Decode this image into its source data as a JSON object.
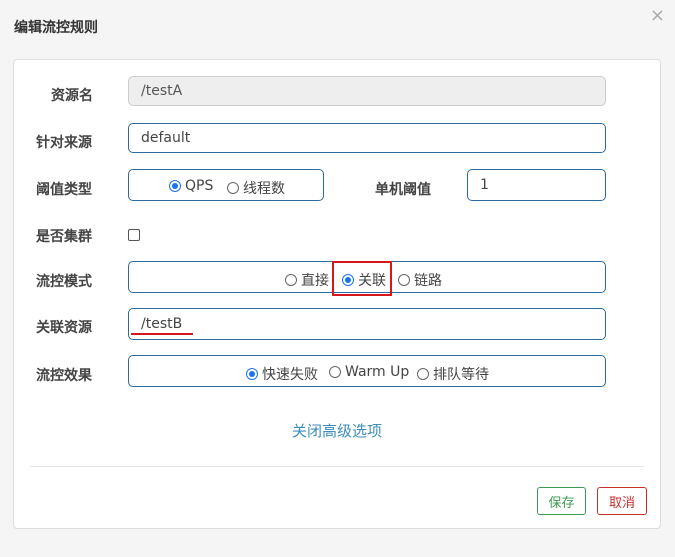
{
  "dialog": {
    "title": "编辑流控规则",
    "close_glyph": "×"
  },
  "form": {
    "resource_name": {
      "label": "资源名",
      "value": "/testA"
    },
    "limit_app": {
      "label": "针对来源",
      "value": "default"
    },
    "threshold_type": {
      "label": "阈值类型",
      "options": [
        "QPS",
        "线程数"
      ],
      "selected": "QPS"
    },
    "single_threshold": {
      "label": "单机阈值",
      "value": "1"
    },
    "cluster_mode": {
      "label": "是否集群",
      "checked": false
    },
    "control_mode": {
      "label": "流控模式",
      "options": [
        "直接",
        "关联",
        "链路"
      ],
      "selected": "关联"
    },
    "ref_resource": {
      "label": "关联资源",
      "value": "/testB"
    },
    "control_effect": {
      "label": "流控效果",
      "options": [
        "快速失败",
        "Warm Up",
        "排队等待"
      ],
      "selected": "快速失败"
    },
    "advanced_toggle": "关闭高级选项"
  },
  "footer": {
    "save_label": "保存",
    "cancel_label": "取消"
  },
  "colors": {
    "accent": "#1a73e8",
    "input_border": "#2d6b9e",
    "save": "#3c9a4f",
    "cancel": "#c9302c",
    "highlight": "#d9161c"
  }
}
